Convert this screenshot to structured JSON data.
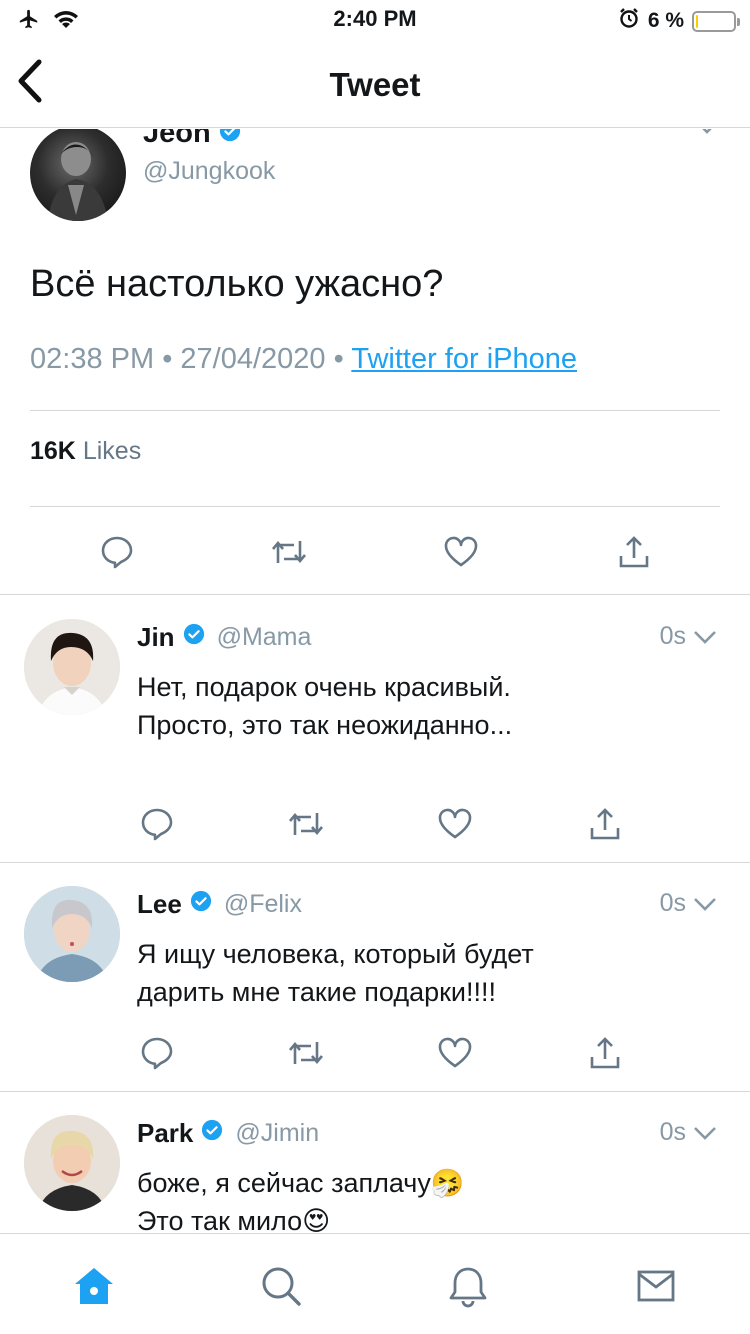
{
  "status_bar": {
    "time": "2:40 PM",
    "battery_text": "6 %",
    "battery_level": 0.06,
    "icons": [
      "airplane-icon",
      "wifi-icon",
      "alarm-icon",
      "battery-icon"
    ]
  },
  "nav": {
    "title": "Tweet",
    "back_icon": "chevron-left-icon"
  },
  "main_tweet": {
    "name": "Jeon",
    "handle": "@Jungkook",
    "text": "Всё настолько ужасно?",
    "time": "02:38 PM",
    "date": "27/04/2020",
    "source": "Twitter for iPhone",
    "separator": "•",
    "likes_count": "16K",
    "likes_label": "Likes"
  },
  "replies": [
    {
      "name": "Jin",
      "handle": "@Mama",
      "time": "0s",
      "lines": [
        "Нет, подарок очень красивый.",
        "Просто, это так неожиданно..."
      ]
    },
    {
      "name": "Lee",
      "handle": "@Felix",
      "time": "0s",
      "lines": [
        "Я ищу человека, который будет",
        "дарить мне такие подарки!!!!"
      ]
    },
    {
      "name": "Park",
      "handle": "@Jimin",
      "time": "0s",
      "lines": [
        "боже, я сейчас заплачу🤧",
        "Это так мило😍"
      ]
    }
  ],
  "colors": {
    "accent": "#1da1f2",
    "muted": "#8899a6",
    "text": "#14171a",
    "divider": "#d5d9dc"
  },
  "tab_bar": {
    "items": [
      "home-icon",
      "search-icon",
      "notifications-icon",
      "messages-icon"
    ],
    "active": "home-icon"
  }
}
